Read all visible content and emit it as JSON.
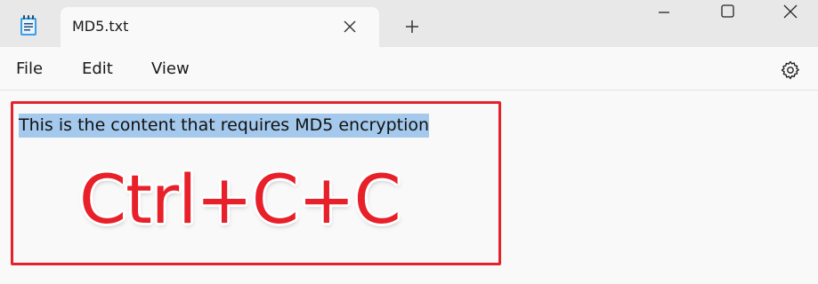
{
  "window": {
    "tab_title": "MD5.txt",
    "new_tab_symbol": "+",
    "app_icon": "notepad-icon",
    "controls": [
      "minimize-icon",
      "maximize-icon",
      "close-icon"
    ]
  },
  "menu": {
    "items": [
      "File",
      "Edit",
      "View"
    ],
    "settings_icon": "gear-icon"
  },
  "editor": {
    "selected_text": "This is the content that requires MD5 encryption",
    "selection_color": "#a4c9ec"
  },
  "annotation": {
    "label": "Ctrl+C+C",
    "color": "#e8202a",
    "box_color": "#e3222c"
  }
}
